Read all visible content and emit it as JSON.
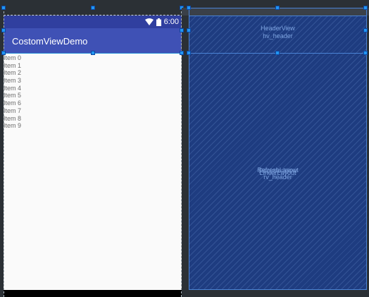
{
  "status_bar": {
    "time": "6:00"
  },
  "app": {
    "title": "CostomViewDemo"
  },
  "list": {
    "items": [
      "Item 0",
      "Item 1",
      "Item 2",
      "Item 3",
      "Item 4",
      "Item 5",
      "Item 6",
      "Item 7",
      "Item 8",
      "Item 9"
    ]
  },
  "blueprint": {
    "header_type": "HeaderView",
    "header_id": "hv_header",
    "body_type_1": "RefreshLayout",
    "body_type_2": "LinearLayout",
    "body_type_3": "RecyclerView",
    "body_id": "rv_header"
  },
  "colors": {
    "status_bar": "#303f9f",
    "app_bar": "#3f51b5",
    "blueprint_bg": "#1e3c80",
    "selection": "#2196f3"
  }
}
